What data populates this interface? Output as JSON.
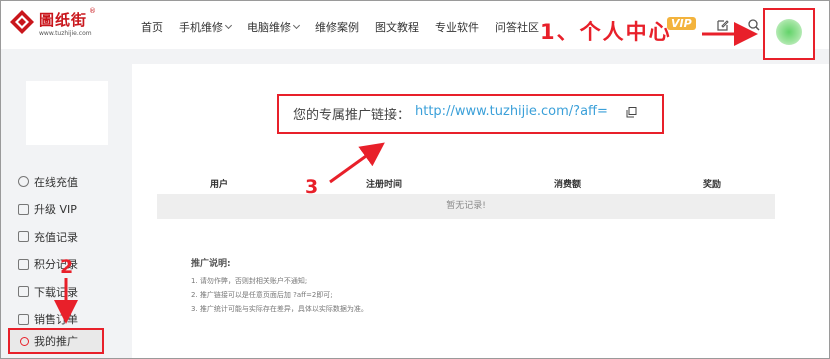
{
  "header": {
    "logo_text": "圖纸街",
    "logo_reg": "®",
    "logo_url": "www.tuzhijie.com",
    "nav": [
      {
        "label": "首页",
        "dropdown": false
      },
      {
        "label": "手机维修",
        "dropdown": true
      },
      {
        "label": "电脑维修",
        "dropdown": true
      },
      {
        "label": "维修案例",
        "dropdown": false
      },
      {
        "label": "图文教程",
        "dropdown": false
      },
      {
        "label": "专业软件",
        "dropdown": false
      },
      {
        "label": "问答社区",
        "dropdown": false
      }
    ],
    "vip_badge": "VIP",
    "icons": [
      "edit-icon",
      "search-icon"
    ]
  },
  "sidebar": {
    "items": [
      {
        "label": "在线充值",
        "icon": "circle-yen-icon"
      },
      {
        "label": "升级 VIP",
        "icon": "crown-icon"
      },
      {
        "label": "充值记录",
        "icon": "receipt-icon"
      },
      {
        "label": "积分记录",
        "icon": "gift-icon"
      },
      {
        "label": "下载记录",
        "icon": "download-icon"
      },
      {
        "label": "销售订单",
        "icon": "order-icon"
      }
    ],
    "active_item": {
      "label": "我的推广",
      "icon": "share-icon"
    }
  },
  "main": {
    "link_label": "您的专属推广链接：",
    "link_url": "http://www.tuzhijie.com/?aff=",
    "table": {
      "headers": [
        "用户",
        "注册时间",
        "消费额",
        "奖励"
      ],
      "empty_text": "暂无记录!"
    },
    "notes_title": "推广说明:",
    "notes": [
      "1.  请勿作弊，否则封相关账户不通知;",
      "2.  推广链接可以是任意页面后加 ?aff=2即可;",
      "3.  推广统计可能与实际存在差异，具体以实际数据为准。"
    ]
  },
  "annotations": {
    "step1": "1、个人中心",
    "step2": "2",
    "step3": "3"
  },
  "colors": {
    "accent_red": "#e8202a",
    "link_blue": "#3ba0d9",
    "vip_gold": "#f3b33d"
  }
}
